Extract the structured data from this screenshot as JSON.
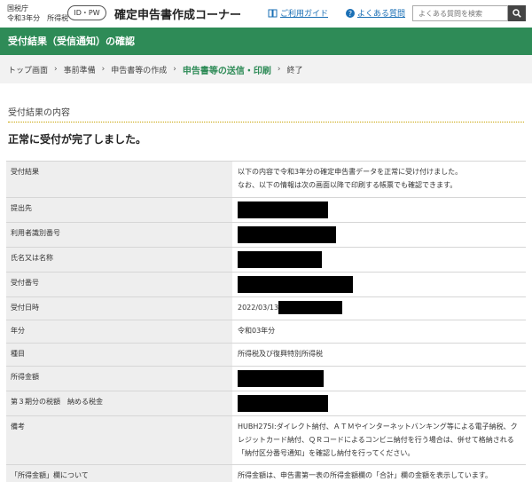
{
  "header": {
    "agency": "国税庁",
    "year_tax": "令和3年分　所得税",
    "idpw": "ID・PW",
    "title": "確定申告書作成コーナー",
    "guide": "ご利用ガイド",
    "faq": "よくある質問",
    "search_placeholder": "よくある質問を検索"
  },
  "page_title": "受付結果（受信通知）の確認",
  "breadcrumb": [
    "トップ画面",
    "事前準備",
    "申告書等の作成",
    "申告書等の送信・印刷",
    "終了"
  ],
  "section_title": "受付結果の内容",
  "message": "正常に受付が完了しました。",
  "rows": [
    {
      "label": "受付結果",
      "value": "以下の内容で令和3年分の確定申告書データを正常に受け付けました。",
      "value2": "なお、以下の情報は次の画面以降で印刷する帳票でも確認できます。"
    },
    {
      "label": "提出先",
      "value": ""
    },
    {
      "label": "利用者識別番号",
      "value": ""
    },
    {
      "label": "氏名又は名称",
      "value": ""
    },
    {
      "label": "受付番号",
      "value": ""
    },
    {
      "label": "受付日時",
      "value": "2022/03/13"
    },
    {
      "label": "年分",
      "value": "令和03年分"
    },
    {
      "label": "種目",
      "value": "所得税及び復興特別所得税"
    },
    {
      "label": "所得金額",
      "value": ""
    },
    {
      "label": "第３期分の税額　納める税金",
      "value": ""
    },
    {
      "label": "備考",
      "value": "HUBH275I:ダイレクト納付、ＡＴＭやインターネットバンキング等による電子納税、クレジットカード納付、ＱＲコードによるコンビニ納付を行う場合は、併せて格納される「納付区分番号通知」を確認し納付を行ってください。"
    },
    {
      "label": "「所得金額」欄について",
      "value": "所得金額は、申告書第一表の所得金額欄の「合計」欄の金額を表示しています。"
    }
  ],
  "colors": {
    "brand_green": "#2e8b57",
    "link_blue": "#1a6fb5",
    "redaction": "#000000"
  },
  "icons": {
    "guide": "book-icon",
    "faq": "question-circle-icon",
    "search": "search-icon"
  }
}
